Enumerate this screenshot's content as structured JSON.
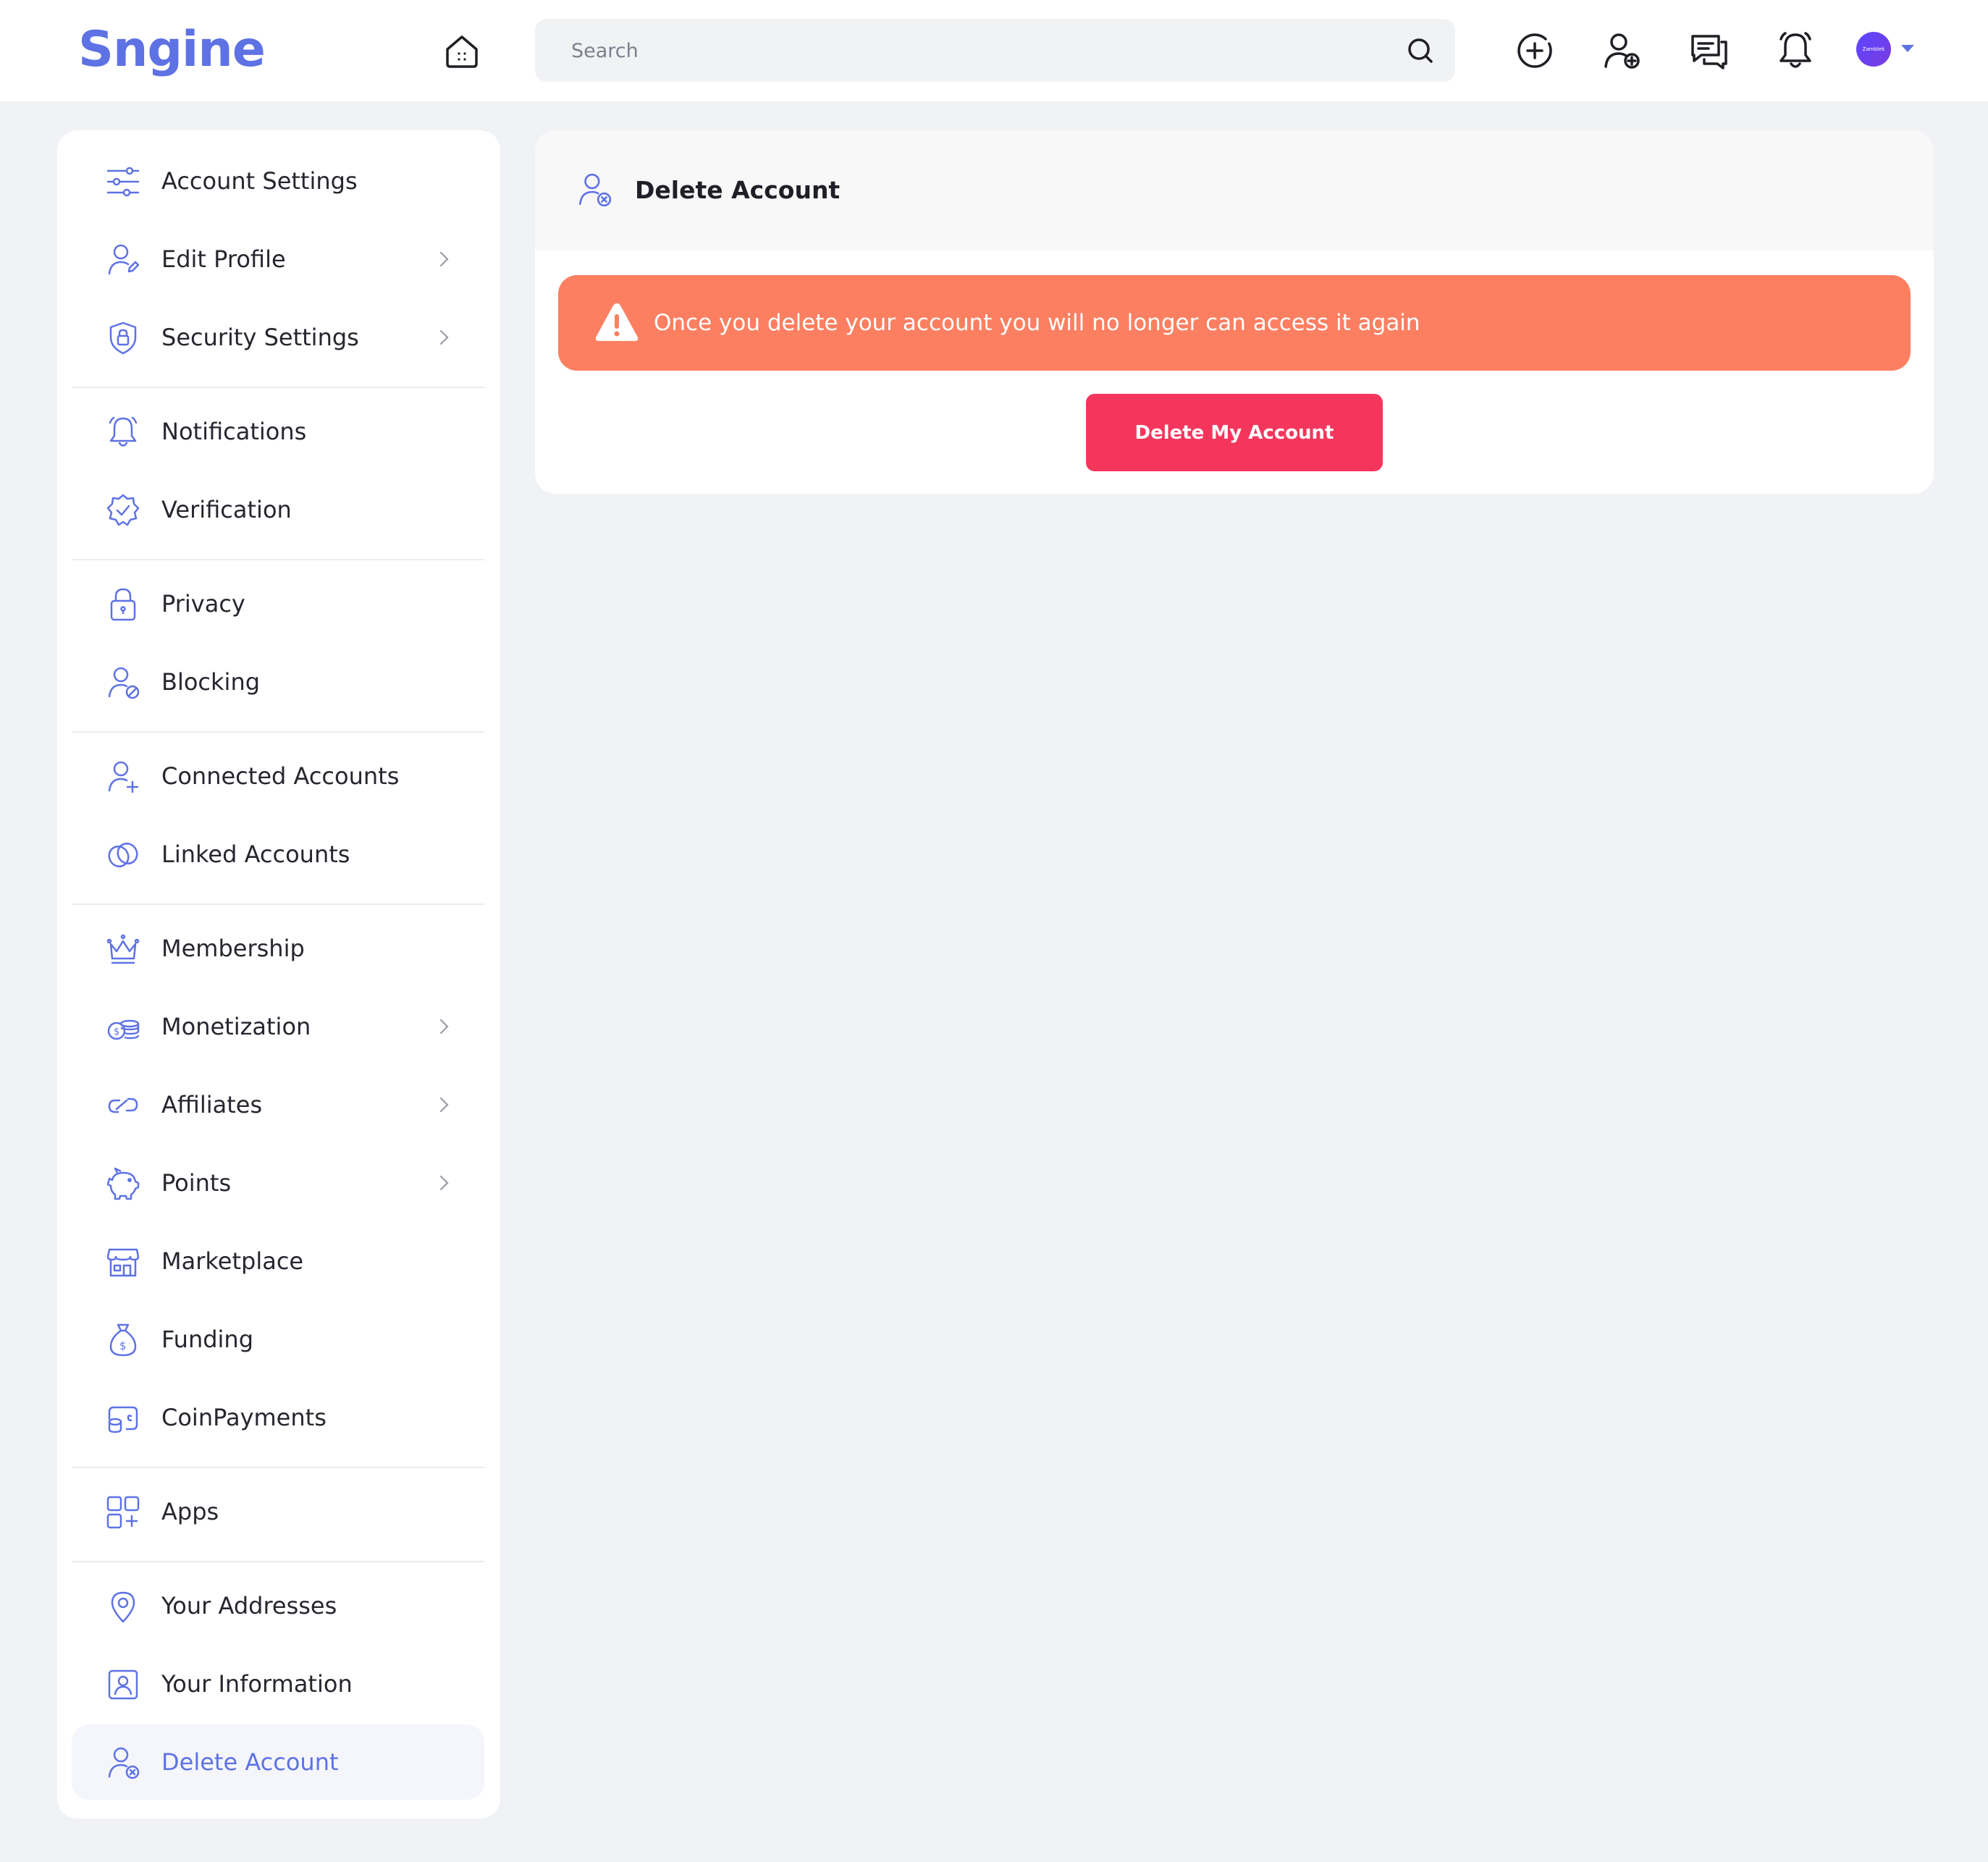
{
  "header": {
    "logo": "Sngine",
    "search_placeholder": "Search",
    "avatar_text": "Zamblek",
    "icons": [
      "home-icon",
      "search-icon",
      "add-circle-icon",
      "add-friend-icon",
      "messages-icon",
      "notifications-bell-icon",
      "chevron-down-icon"
    ]
  },
  "sidebar": {
    "items": [
      {
        "label": "Account Settings",
        "icon": "sliders-icon"
      },
      {
        "label": "Edit Profile",
        "icon": "user-edit-icon",
        "has_submenu": true
      },
      {
        "label": "Security Settings",
        "icon": "shield-lock-icon",
        "has_submenu": true
      },
      {
        "label": "Notifications",
        "icon": "bell-icon"
      },
      {
        "label": "Verification",
        "icon": "verified-badge-icon"
      },
      {
        "label": "Privacy",
        "icon": "lock-icon"
      },
      {
        "label": "Blocking",
        "icon": "user-block-icon"
      },
      {
        "label": "Connected Accounts",
        "icon": "user-plus-icon"
      },
      {
        "label": "Linked Accounts",
        "icon": "link-icon"
      },
      {
        "label": "Membership",
        "icon": "crown-icon"
      },
      {
        "label": "Monetization",
        "icon": "coins-icon",
        "has_submenu": true
      },
      {
        "label": "Affiliates",
        "icon": "affiliates-link-icon",
        "has_submenu": true
      },
      {
        "label": "Points",
        "icon": "piggy-bank-icon",
        "has_submenu": true
      },
      {
        "label": "Marketplace",
        "icon": "store-icon"
      },
      {
        "label": "Funding",
        "icon": "money-bag-icon"
      },
      {
        "label": "CoinPayments",
        "icon": "coin-payments-icon"
      },
      {
        "label": "Apps",
        "icon": "apps-grid-icon"
      },
      {
        "label": "Your Addresses",
        "icon": "location-pin-icon"
      },
      {
        "label": "Your Information",
        "icon": "id-card-icon"
      },
      {
        "label": "Delete Account",
        "icon": "user-remove-icon",
        "active": true
      }
    ]
  },
  "main": {
    "title": "Delete Account",
    "title_icon": "user-remove-icon",
    "alert": {
      "text": "Once you delete your account you will no longer can access it again",
      "icon": "warning-triangle-icon",
      "color": "#fd7f61"
    },
    "delete_button_label": "Delete My Account",
    "delete_button_color": "#f5365c"
  },
  "colors": {
    "accent": "#5e72e4",
    "background": "#f0f2f5",
    "card": "#ffffff"
  }
}
